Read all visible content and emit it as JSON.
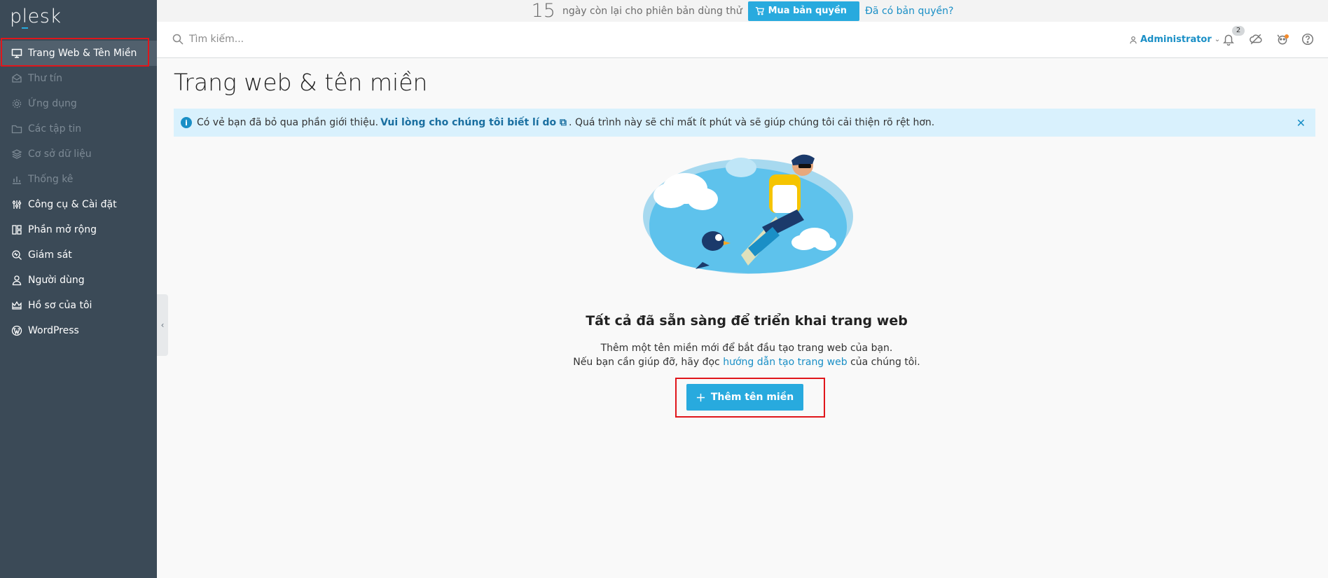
{
  "app": {
    "logo": "plesk"
  },
  "trial": {
    "days": "15",
    "text": "ngày còn lại cho phiên bản dùng thử",
    "buy_label": "Mua bản quyền",
    "have_license_link": "Đã có bản quyền?"
  },
  "header": {
    "search_placeholder": "Tìm kiếm...",
    "user": "Administrator",
    "notification_count": "2"
  },
  "sidebar": {
    "items": [
      {
        "label": "Trang Web & Tên Miền",
        "icon": "monitor-icon",
        "state": "active"
      },
      {
        "label": "Thư tín",
        "icon": "mail-icon",
        "state": "disabled"
      },
      {
        "label": "Ứng dụng",
        "icon": "gear-icon",
        "state": "disabled"
      },
      {
        "label": "Các tập tin",
        "icon": "folder-icon",
        "state": "disabled"
      },
      {
        "label": "Cơ sở dữ liệu",
        "icon": "database-icon",
        "state": "disabled"
      },
      {
        "label": "Thống kê",
        "icon": "bar-chart-icon",
        "state": "disabled"
      },
      {
        "label": "Công cụ & Cài đặt",
        "icon": "sliders-icon",
        "state": "normal"
      },
      {
        "label": "Phần mở rộng",
        "icon": "extensions-icon",
        "state": "normal"
      },
      {
        "label": "Giám sát",
        "icon": "monitoring-icon",
        "state": "normal"
      },
      {
        "label": "Người dùng",
        "icon": "user-icon",
        "state": "normal"
      },
      {
        "label": "Hồ sơ của tôi",
        "icon": "crown-icon",
        "state": "normal"
      },
      {
        "label": "WordPress",
        "icon": "wordpress-icon",
        "state": "normal"
      }
    ]
  },
  "main": {
    "title": "Trang web & tên miền",
    "banner": {
      "text_before": "Có vẻ bạn đã bỏ qua phần giới thiệu.",
      "link": "Vui lòng cho chúng tôi biết lí do",
      "text_after": ". Quá trình này sẽ chỉ mất ít phút và sẽ giúp chúng tôi cải thiện rõ rệt hơn."
    },
    "empty": {
      "title": "Tất cả đã sẵn sàng để triển khai trang web",
      "line1": "Thêm một tên miền mới để bắt đầu tạo trang web của bạn.",
      "line2_before": "Nếu bạn cần giúp đỡ, hãy đọc",
      "line2_link": "hướng dẫn tạo trang web",
      "line2_after": "của chúng tôi."
    },
    "add_button": "Thêm tên miền"
  },
  "colors": {
    "accent": "#28aade",
    "sidebar": "#3b4a57",
    "highlight": "#e0161b"
  }
}
